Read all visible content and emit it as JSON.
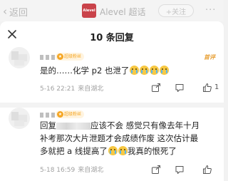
{
  "topbar": {
    "back_label": "返回",
    "logo_text": "Alevel",
    "title": "Alevel 超话",
    "follow_label": "+关注",
    "menu_label": "···"
  },
  "sheet": {
    "title": "10 条回复"
  },
  "comments": [
    {
      "badge": "超级粉丝",
      "tag": "首评",
      "text": "是的……化学 p2 也泄了",
      "emoji_count": 4,
      "time": "5-16 22:21",
      "location": "来自湖北",
      "likes": "1"
    },
    {
      "badge": "超级粉丝",
      "text_line1_prefix": "回复",
      "text_line1_suffix": "应该不会 感觉只有像去年十月",
      "text_line2": "补考那次大片泄题才会成绩作废 这次估计最",
      "text_line3_a": "多就把 a 线提高了",
      "text_line3_b": "我真的恨死了",
      "time": "5-18 16:59",
      "location": "来自湖北"
    }
  ]
}
